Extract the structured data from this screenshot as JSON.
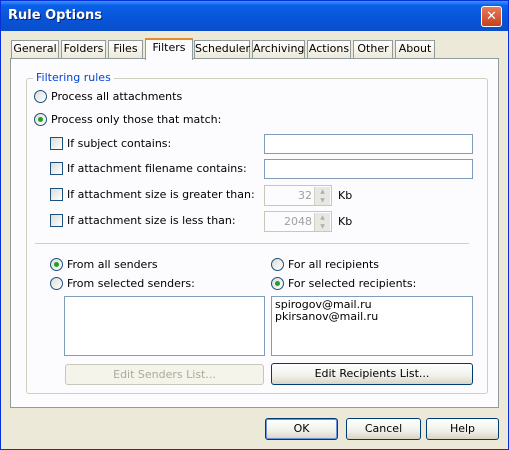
{
  "window": {
    "title": "Rule Options",
    "close_glyph": "✕"
  },
  "tabs": [
    {
      "label": "General"
    },
    {
      "label": "Folders"
    },
    {
      "label": "Files"
    },
    {
      "label": "Filters",
      "active": true
    },
    {
      "label": "Scheduler"
    },
    {
      "label": "Archiving"
    },
    {
      "label": "Actions"
    },
    {
      "label": "Other"
    },
    {
      "label": "About"
    }
  ],
  "filtering": {
    "group_label": "Filtering rules",
    "process_all_label": "Process all attachments",
    "process_all_selected": false,
    "process_match_label": "Process only those that match:",
    "process_match_selected": true,
    "subject_label": "If subject contains:",
    "subject_value": "",
    "filename_label": "If attachment filename contains:",
    "filename_value": "",
    "size_greater_label": "If attachment size is greater than:",
    "size_greater_value": "32",
    "size_greater_unit": "Kb",
    "size_less_label": "If attachment size is less than:",
    "size_less_value": "2048",
    "size_less_unit": "Kb"
  },
  "senders": {
    "all_label": "From all senders",
    "all_selected": true,
    "selected_label": "From selected senders:",
    "list": [],
    "edit_button": "Edit Senders List..."
  },
  "recipients": {
    "all_label": "For all recipients",
    "all_selected": false,
    "selected_label": "For selected recipients:",
    "list": [
      "spirogov@mail.ru",
      "pkirsanov@mail.ru"
    ],
    "edit_button": "Edit Recipients List..."
  },
  "footer": {
    "ok": "OK",
    "cancel": "Cancel",
    "help": "Help"
  }
}
